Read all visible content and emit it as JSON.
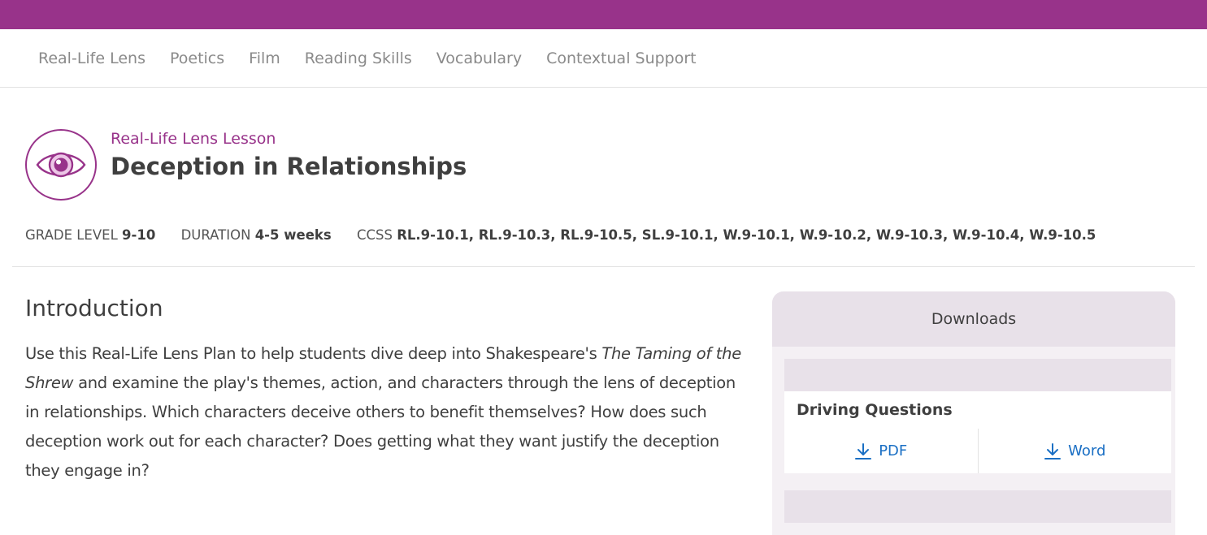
{
  "nav": {
    "items": [
      {
        "label": "Real-Life Lens"
      },
      {
        "label": "Poetics"
      },
      {
        "label": "Film"
      },
      {
        "label": "Reading Skills"
      },
      {
        "label": "Vocabulary"
      },
      {
        "label": "Contextual Support"
      }
    ]
  },
  "lesson": {
    "icon": "eye-icon",
    "type": "Real-Life Lens Lesson",
    "title": "Deception in Relationships",
    "grade_label": "GRADE LEVEL",
    "grade_value": "9-10",
    "duration_label": "DURATION",
    "duration_value": "4-5 weeks",
    "ccss_label": "CCSS",
    "ccss_value": "RL.9-10.1, RL.9-10.3, RL.9-10.5, SL.9-10.1, W.9-10.1, W.9-10.2, W.9-10.3, W.9-10.4, W.9-10.5"
  },
  "intro": {
    "heading": "Introduction",
    "text_before": "Use this Real-Life Lens Plan to help students dive deep into Shakespeare's ",
    "text_italic": "The Taming of the Shrew",
    "text_after": " and examine the play's themes, action, and characters through the lens of deception in relationships. Which characters deceive others to benefit themselves? How does such deception work out for each character? Does getting what they want justify the deception they engage in?"
  },
  "downloads": {
    "heading": "Downloads",
    "items": [
      {
        "title": "Driving Questions",
        "pdf_label": "PDF",
        "word_label": "Word"
      }
    ]
  },
  "colors": {
    "brand": "#98338a",
    "link": "#1a6fc4",
    "panel": "#e8e1e9"
  }
}
